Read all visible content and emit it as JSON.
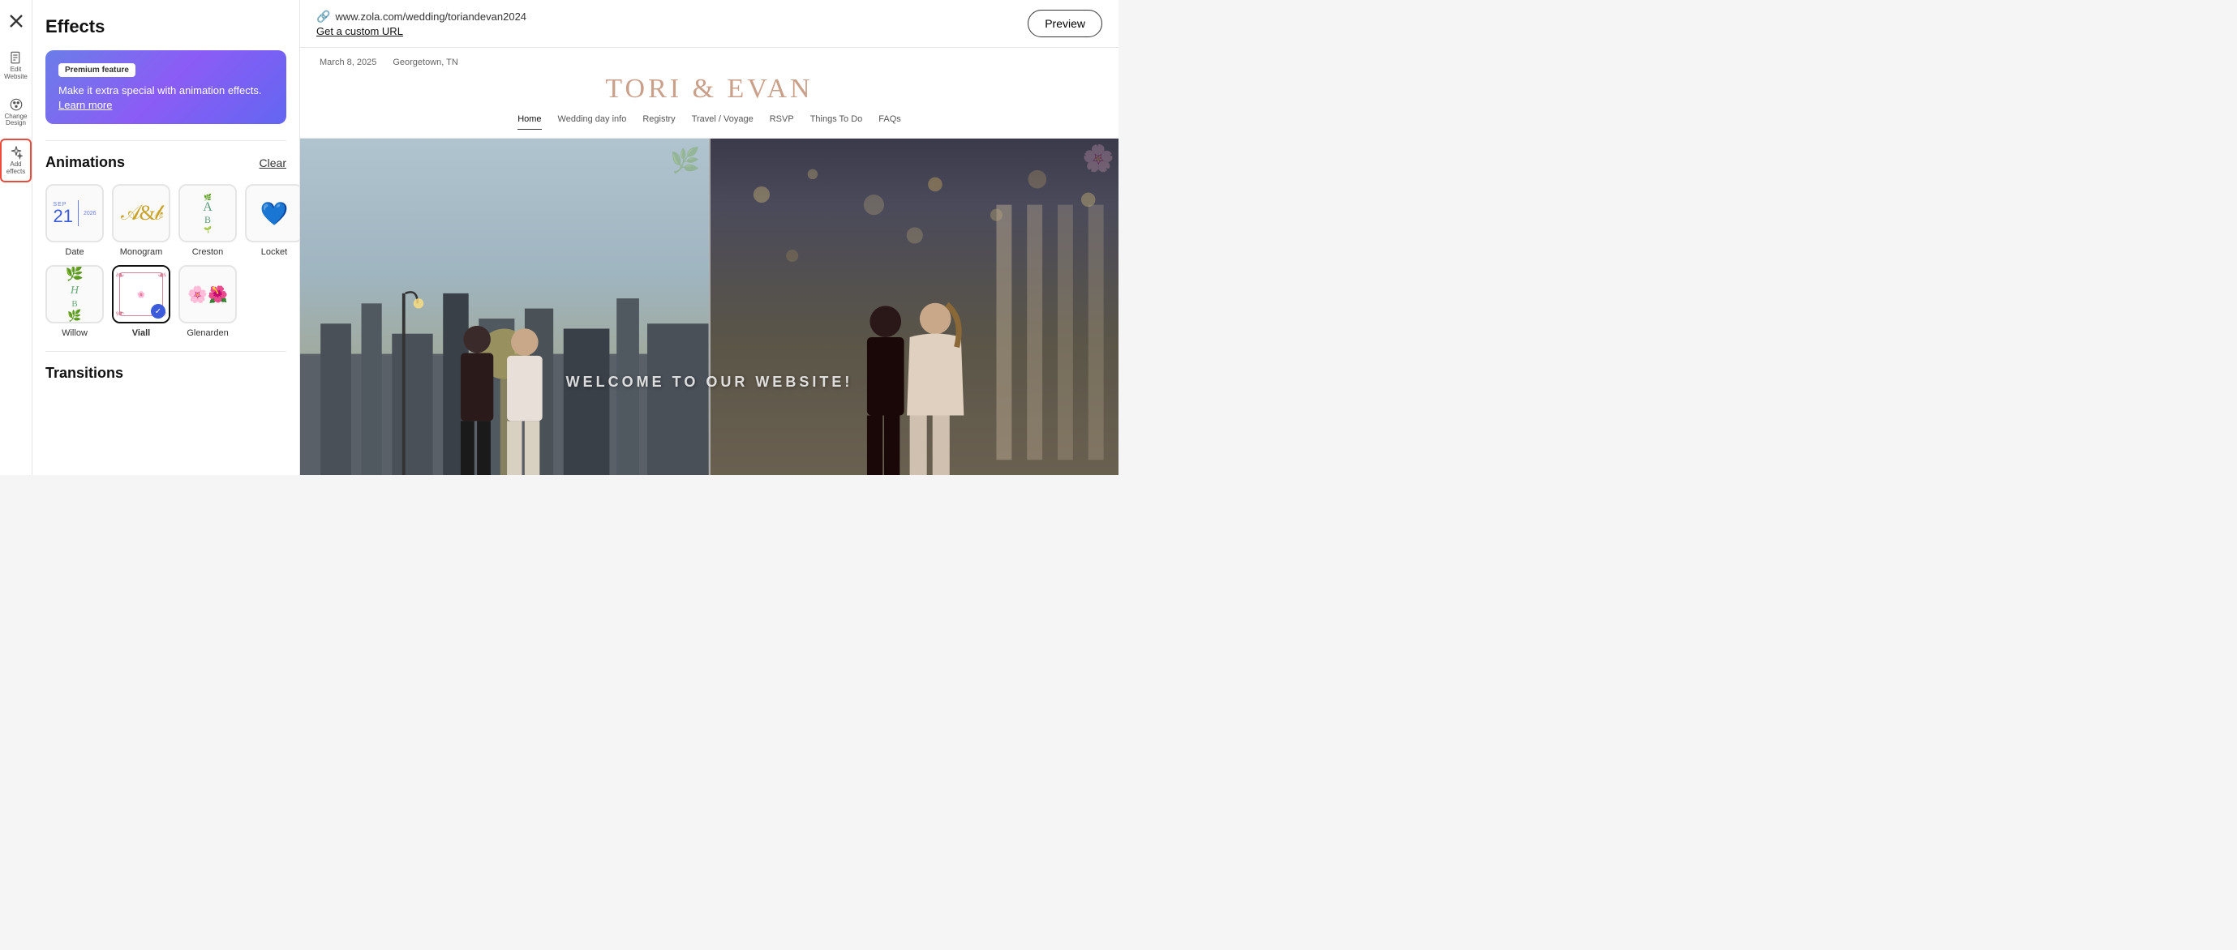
{
  "sidebar": {
    "close_icon": "×",
    "items": [
      {
        "id": "edit-website",
        "icon": "document",
        "label": "Edit\nWebsite"
      },
      {
        "id": "change-design",
        "icon": "palette",
        "label": "Change\nDesign"
      },
      {
        "id": "add-effects",
        "icon": "sparkle",
        "label": "Add\neffects",
        "active": true
      }
    ]
  },
  "effects_panel": {
    "title": "Effects",
    "premium": {
      "badge": "Premium feature",
      "text": "Make it extra special with animation effects.",
      "link_text": "Learn more"
    },
    "animations": {
      "title": "Animations",
      "clear_label": "Clear",
      "items": [
        {
          "id": "date",
          "label": "Date",
          "selected": false
        },
        {
          "id": "monogram",
          "label": "Monogram",
          "selected": false
        },
        {
          "id": "creston",
          "label": "Creston",
          "selected": false
        },
        {
          "id": "locket",
          "label": "Locket",
          "selected": false
        },
        {
          "id": "willow",
          "label": "Willow",
          "selected": false
        },
        {
          "id": "viall",
          "label": "Viall",
          "selected": true
        },
        {
          "id": "glenarden",
          "label": "Glenarden",
          "selected": false
        }
      ]
    },
    "transitions": {
      "title": "Transitions"
    }
  },
  "preview": {
    "url": "www.zola.com/wedding/toriandevan2024",
    "custom_url_text": "Get a custom URL",
    "preview_button": "Preview",
    "wedding": {
      "date": "March 8, 2025",
      "location": "Georgetown, TN",
      "couple_name": "TORI & EVAN",
      "nav_items": [
        {
          "label": "Home",
          "active": true
        },
        {
          "label": "Wedding day info",
          "active": false
        },
        {
          "label": "Registry",
          "active": false
        },
        {
          "label": "Travel / Voyage",
          "active": false
        },
        {
          "label": "RSVP",
          "active": false
        },
        {
          "label": "Things To Do",
          "active": false
        },
        {
          "label": "FAQs",
          "active": false
        }
      ],
      "hero_text": "WELCOME TO OUR WEBSITE!"
    }
  }
}
